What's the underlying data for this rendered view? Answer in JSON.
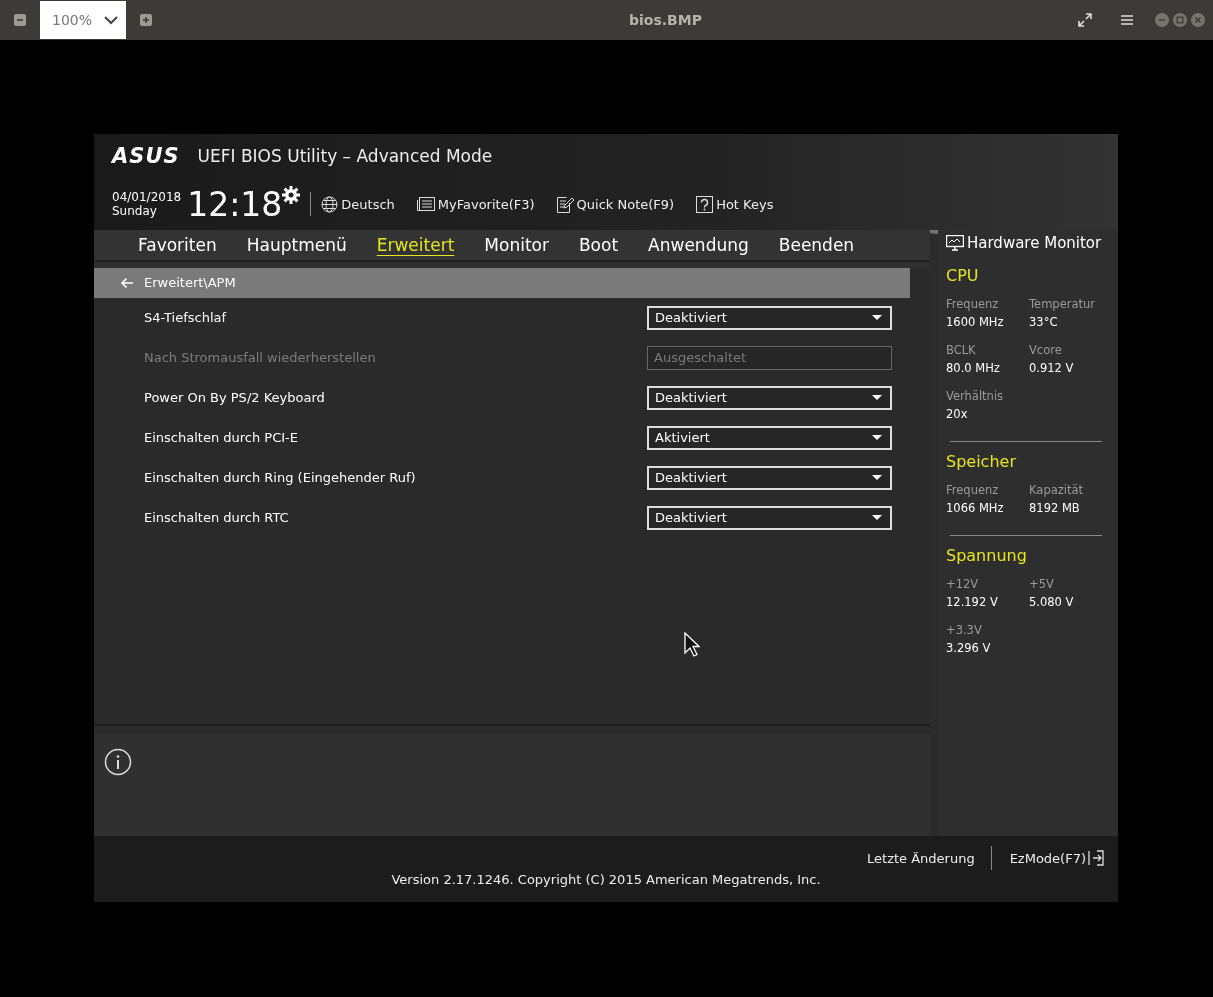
{
  "viewer": {
    "zoom": "100%",
    "title": "bios.BMP"
  },
  "bios": {
    "logo": "ASUS",
    "title": "UEFI BIOS Utility – Advanced Mode",
    "date": "04/01/2018",
    "day": "Sunday",
    "time": "12:18",
    "tools": [
      {
        "kind": "globe",
        "label": "Deutsch"
      },
      {
        "kind": "list",
        "label": "MyFavorite(F3)"
      },
      {
        "kind": "note",
        "label": "Quick Note(F9)"
      },
      {
        "kind": "help",
        "label": "Hot Keys"
      }
    ],
    "tabs": [
      {
        "label": "Favoriten",
        "selected": false
      },
      {
        "label": "Hauptmenü",
        "selected": false
      },
      {
        "label": "Erweitert",
        "selected": true
      },
      {
        "label": "Monitor",
        "selected": false
      },
      {
        "label": "Boot",
        "selected": false
      },
      {
        "label": "Anwendung",
        "selected": false
      },
      {
        "label": "Beenden",
        "selected": false
      }
    ],
    "breadcrumb": "Erweitert\\APM",
    "settings": [
      {
        "label": "S4-Tiefschlaf",
        "value": "Deaktiviert",
        "disabled": false
      },
      {
        "label": "Nach Stromausfall wiederherstellen",
        "value": "Ausgeschaltet",
        "disabled": true
      },
      {
        "label": "Power On By PS/2 Keyboard",
        "value": "Deaktiviert",
        "disabled": false
      },
      {
        "label": "Einschalten durch PCI-E",
        "value": "Aktiviert",
        "disabled": false
      },
      {
        "label": "Einschalten durch Ring (Eingehender Ruf)",
        "value": "Deaktiviert",
        "disabled": false
      },
      {
        "label": "Einschalten durch RTC",
        "value": "Deaktiviert",
        "disabled": false
      }
    ],
    "hardware_monitor": {
      "title": "Hardware Monitor",
      "sections": [
        {
          "title": "CPU",
          "items": [
            {
              "label": "Frequenz",
              "value": "1600 MHz"
            },
            {
              "label": "Temperatur",
              "value": "33°C"
            },
            {
              "label": "BCLK",
              "value": "80.0 MHz"
            },
            {
              "label": "Vcore",
              "value": "0.912 V"
            },
            {
              "label": "Verhältnis",
              "value": "20x"
            }
          ]
        },
        {
          "title": "Speicher",
          "items": [
            {
              "label": "Frequenz",
              "value": "1066 MHz"
            },
            {
              "label": "Kapazität",
              "value": "8192 MB"
            }
          ]
        },
        {
          "title": "Spannung",
          "items": [
            {
              "label": "+12V",
              "value": "12.192 V"
            },
            {
              "label": "+5V",
              "value": "5.080 V"
            },
            {
              "label": "+3.3V",
              "value": "3.296 V"
            }
          ]
        }
      ]
    },
    "footer": {
      "last_change": "Letzte Änderung",
      "ezmode": "EzMode(F7)",
      "version": "Version 2.17.1246. Copyright (C) 2015 American Megatrends, Inc."
    }
  }
}
